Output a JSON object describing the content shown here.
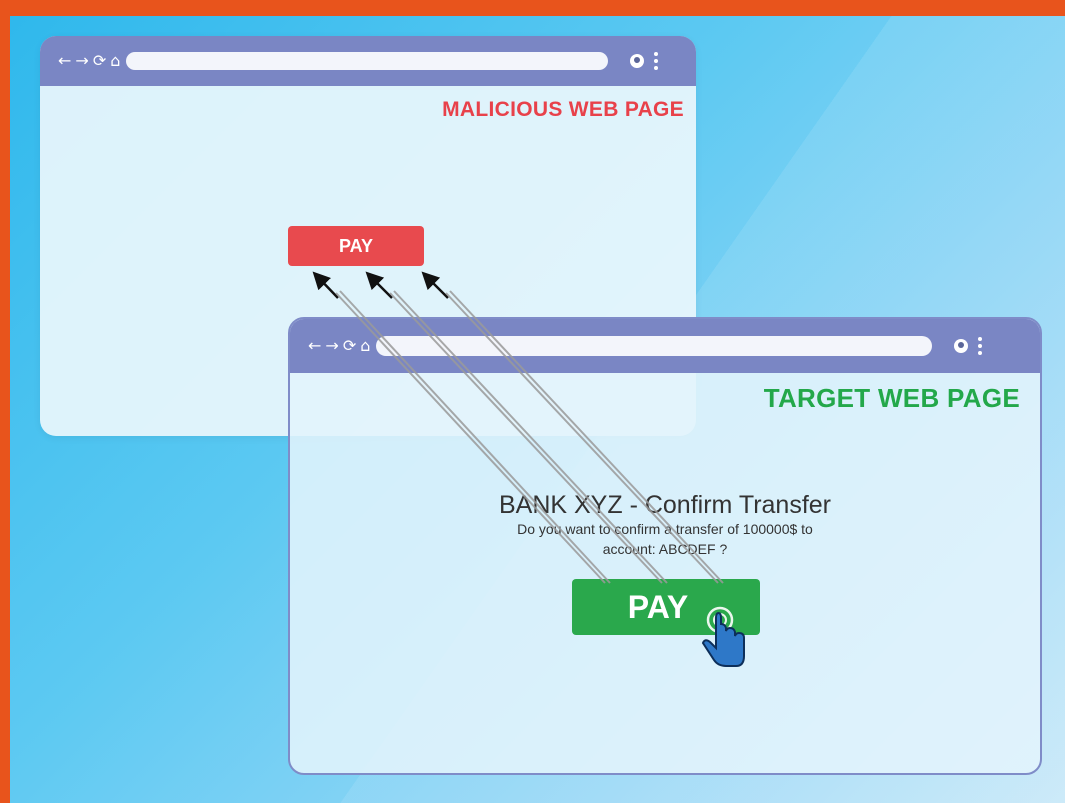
{
  "malicious_page": {
    "label": "MALICIOUS WEB PAGE",
    "button_label": "PAY"
  },
  "target_page": {
    "label": "TARGET WEB PAGE",
    "title": "BANK XYZ - Confirm Transfer",
    "message_line1": "Do you want to confirm a transfer of 100000$ to",
    "message_line2": "account: ABCDEF ?",
    "button_label": "PAY"
  },
  "icons": [
    "back-arrow-icon",
    "forward-arrow-icon",
    "reload-icon",
    "home-icon",
    "profile-icon",
    "kebab-menu-icon",
    "hand-pointer-icon"
  ],
  "colors": {
    "background": "#2fb8ec",
    "border": "#e8541c",
    "toolbar": "#7a86c4",
    "malicious_accent": "#e8414a",
    "target_accent": "#23a84a"
  }
}
